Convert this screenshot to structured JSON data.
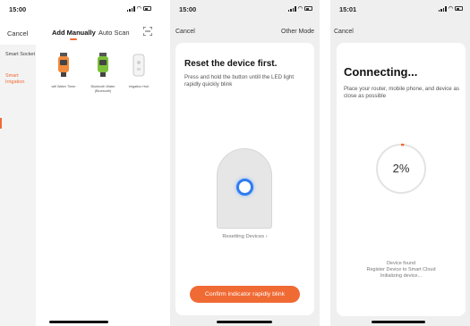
{
  "phone1": {
    "status_time": "15:00",
    "nav": {
      "cancel": "Cancel",
      "tabs": [
        "Add Manually",
        "Auto Scan"
      ]
    },
    "sidebar": [
      {
        "label": "Smart Socket"
      },
      {
        "label": "Smart Irrigation",
        "active": true
      }
    ],
    "products": [
      {
        "label": "wifi Water Timer",
        "icon": "water-timer-wifi-icon"
      },
      {
        "label": "Bluetooth Water (Bluetooth)",
        "icon": "water-timer-bluetooth-icon"
      },
      {
        "label": "Irrigation Hub",
        "icon": "irrigation-hub-icon"
      }
    ]
  },
  "phone2": {
    "status_time": "15:00",
    "nav": {
      "cancel": "Cancel",
      "other_mode": "Other Mode"
    },
    "title": "Reset the device first.",
    "description": "Press and hold the button untill the LED light rapidly quickly blink",
    "reset_link": "Resetting Devices ›",
    "confirm_button": "Confirm indicator rapidly blink"
  },
  "phone3": {
    "status_time": "15:01",
    "nav": {
      "cancel": "Cancel"
    },
    "title": "Connecting...",
    "description": "Place your router, mobile phone, and device as close as possible",
    "progress_percent": "2%",
    "progress_value": 0.02,
    "steps": [
      "Device found",
      "Register Device to Smart Cloud",
      "Initializing device..."
    ]
  },
  "colors": {
    "accent": "#f06a34",
    "led": "#2f7cf0"
  }
}
